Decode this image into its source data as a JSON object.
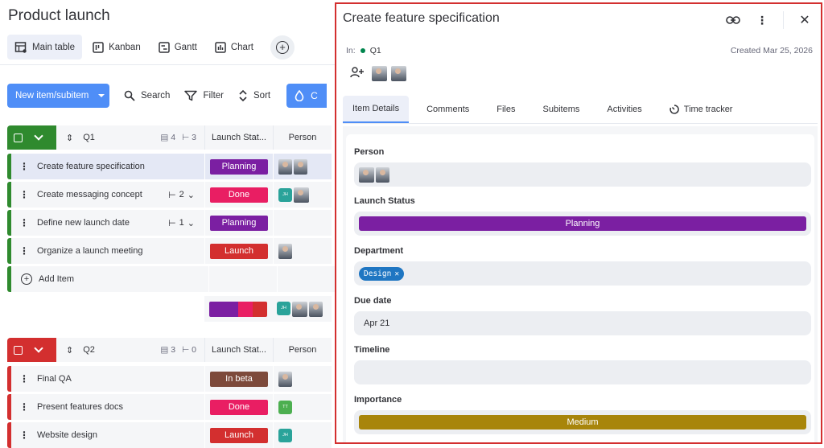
{
  "board": {
    "title": "Product launch",
    "views": [
      {
        "label": "Main table",
        "icon": "table-icon"
      },
      {
        "label": "Kanban",
        "icon": "kanban-icon"
      },
      {
        "label": "Gantt",
        "icon": "gantt-icon"
      },
      {
        "label": "Chart",
        "icon": "chart-icon"
      }
    ],
    "add_view_icon": "plus-circle-icon"
  },
  "toolbar": {
    "new_item_label": "New item/subitem",
    "search_label": "Search",
    "filter_label": "Filter",
    "sort_label": "Sort",
    "cut_label": "C"
  },
  "groups": [
    {
      "name": "Q1",
      "color": "#2f8a2e",
      "items_count": "4",
      "subitems_count": "3",
      "status_header": "Launch Stat...",
      "person_header": "Person",
      "rows": [
        {
          "name": "Create feature specification",
          "status": "Planning",
          "status_color": "#7b1fa2",
          "sub": "",
          "people": [
            "avatar",
            "avatar"
          ]
        },
        {
          "name": "Create messaging concept",
          "status": "Done",
          "status_color": "#e91e63",
          "sub": "2",
          "people": [
            "JH",
            "avatar"
          ]
        },
        {
          "name": "Define new launch date",
          "status": "Planning",
          "status_color": "#7b1fa2",
          "sub": "1",
          "people": []
        },
        {
          "name": "Organize a launch meeting",
          "status": "Launch",
          "status_color": "#d32f2f",
          "sub": "",
          "people": [
            "avatar"
          ]
        }
      ],
      "add_item_label": "Add Item"
    },
    {
      "name": "Q2",
      "color": "#d32f2f",
      "items_count": "3",
      "subitems_count": "0",
      "status_header": "Launch Stat...",
      "person_header": "Person",
      "rows": [
        {
          "name": "Final QA",
          "status": "In beta",
          "status_color": "#7d4a3b",
          "people": [
            "avatar"
          ]
        },
        {
          "name": "Present features docs",
          "status": "Done",
          "status_color": "#e91e63",
          "people": [
            "TT"
          ]
        },
        {
          "name": "Website design",
          "status": "Launch",
          "status_color": "#d32f2f",
          "people": [
            "JH"
          ]
        }
      ]
    }
  ],
  "panel": {
    "title": "Create feature specification",
    "in_label": "In:",
    "group": "Q1",
    "created": "Created Mar 25, 2026",
    "tabs": [
      "Item Details",
      "Comments",
      "Files",
      "Subitems",
      "Activities",
      "Time tracker"
    ],
    "fields": {
      "person_label": "Person",
      "status_label": "Launch Status",
      "status_value": "Planning",
      "department_label": "Department",
      "department_value": "Design",
      "due_label": "Due date",
      "due_value": "Apr 21",
      "timeline_label": "Timeline",
      "importance_label": "Importance",
      "importance_value": "Medium"
    }
  },
  "colors": {
    "accent": "#4f8ef7",
    "planning": "#7b1fa2",
    "done": "#e91e63",
    "launch": "#d32f2f",
    "in_beta": "#7d4a3b",
    "medium": "#a8850b",
    "jh": "#2aa39a",
    "tt": "#4caf50",
    "panel_border": "#d32f2f"
  }
}
